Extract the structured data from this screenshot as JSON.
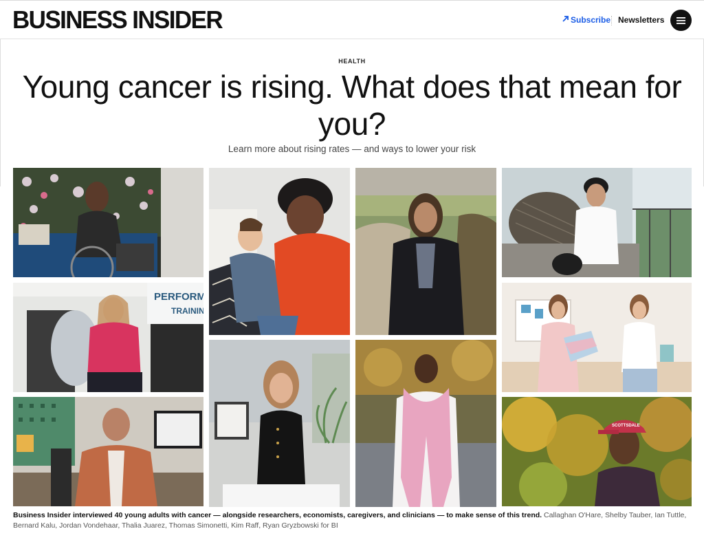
{
  "header": {
    "logo": "BUSINESS INSIDER",
    "subscribe_label": "Subscribe",
    "newsletters_label": "Newsletters"
  },
  "article": {
    "section": "HEALTH",
    "headline": "Young cancer is rising. What does that mean for you?",
    "dek": "Learn more about rising rates — and ways to lower your risk"
  },
  "caption": {
    "text": "Business Insider interviewed 40 young adults with cancer — alongside researchers, economists, caregivers, and clinicians — to make sense of this trend.",
    "credit": "Callaghan O'Hare, Shelby Tauber, Ian Tuttle, Bernard Kalu, Jordan Vondehaar, Thalia Juarez, Thomas Simonetti, Kim Raff, Ryan Gryzbowski for BI"
  },
  "photo_overlay_text": {
    "gym_banner": "PERFORMANCE",
    "gym_banner_2": "TRAINING",
    "hat_text": "SCOTTSDALE"
  },
  "colors": {
    "subscribe_blue": "#1a5ce6",
    "menu_button": "#111111",
    "text_primary": "#111111",
    "text_secondary": "#444444"
  },
  "icons": {
    "subscribe": "arrow-up-right-icon",
    "menu": "hamburger-menu-icon"
  }
}
